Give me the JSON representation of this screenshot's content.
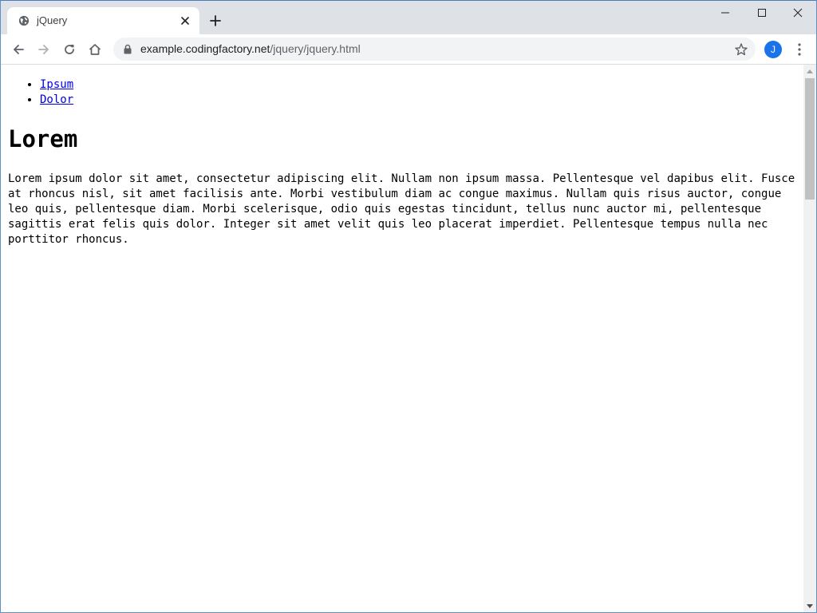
{
  "browser": {
    "tab": {
      "title": "jQuery"
    },
    "address_bar": {
      "host": "example.codingfactory.net",
      "path": "/jquery/jquery.html"
    },
    "profile_initial": "J",
    "accent_color": "#1a73e8"
  },
  "page": {
    "nav_links": [
      {
        "label": "Ipsum"
      },
      {
        "label": "Dolor"
      }
    ],
    "heading": "Lorem",
    "paragraph": "Lorem ipsum dolor sit amet, consectetur adipiscing elit. Nullam non ipsum massa. Pellentesque vel dapibus elit. Fusce at rhoncus nisl, sit amet facilisis ante. Morbi vestibulum diam ac congue maximus. Nullam quis risus auctor, congue leo quis, pellentesque diam. Morbi scelerisque, odio quis egestas tincidunt, tellus nunc auctor mi, pellentesque sagittis erat felis quis dolor. Integer sit amet velit quis leo placerat imperdiet. Pellentesque tempus nulla nec porttitor rhoncus."
  },
  "icons": {
    "tab_favicon": "globe-icon",
    "tab_close": "close-icon",
    "new_tab": "plus-icon",
    "back": "arrow-left-icon",
    "forward": "arrow-right-icon",
    "reload": "reload-icon",
    "home": "home-icon",
    "lock": "lock-icon",
    "bookmark": "star-icon",
    "menu": "more-vert-icon"
  }
}
